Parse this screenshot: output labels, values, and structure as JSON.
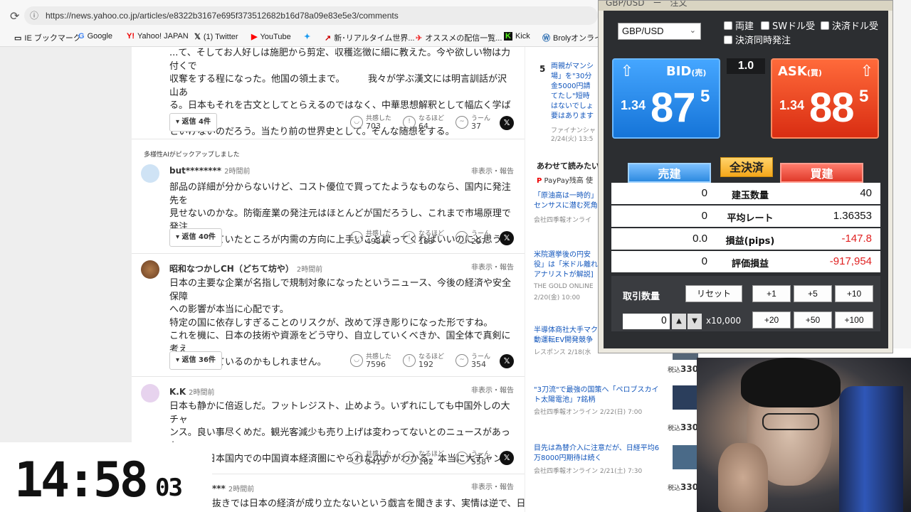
{
  "browser": {
    "url": "https://news.yahoo.co.jp/articles/e8322b3167e695f373512682b16d78a09e83e5e3/comments",
    "bookmarks": [
      "IE ブックマーク",
      "Google",
      "Yahoo! JAPAN",
      "(1) Twitter",
      "YouTube",
      "",
      "新･リアルタイム世界...",
      "オススメの配信一覧...",
      "Kick",
      "Brolyオンライン"
    ]
  },
  "comments": [
    {
      "text_lines": [
        "...て、そしてお人好しは施肥から剪定、収穫迄徴に細に教えた。今や欲しい物は力付くで",
        "収奪をする程になった。他国の領土まで。　　　我々が学ぶ漢文には明言訓話が沢山あ",
        "る。日本もそれを古文としてとらえるのではなく、中華思想解釈として幅広く学ばない",
        "といけないのだろう。当たり前の世界史として。そんな随想をする。"
      ],
      "reply": "返信 4件",
      "reactions": [
        {
          "label": "共感した",
          "count": "703"
        },
        {
          "label": "なるほど",
          "count": "64"
        },
        {
          "label": "うーん",
          "count": "37"
        }
      ]
    },
    {
      "ai_tag": "多様性AIがピックアップしました",
      "user": "but********",
      "time": "2時間前",
      "report": "非表示・報告",
      "text_lines": [
        "部品の詳細が分からないけど、コスト優位で買ってたようなものなら、国内に発注先を",
        "見せないのかな。防衛産業の発注元はほとんどが国だろうし、これまで市場原理で発注",
        "先選定されていたところが内需の方向に上手いこと戻ってくればいいのにと思う。"
      ],
      "reply": "返信 40件",
      "reactions": [
        {
          "label": "共感した",
          "count": "4984"
        },
        {
          "label": "なるほど",
          "count": "183"
        },
        {
          "label": "うーん",
          "count": "297"
        }
      ]
    },
    {
      "user": "昭和なつかしCH（どちて坊や）",
      "time": "2時間前",
      "report": "非表示・報告",
      "text_lines": [
        "日本の主要な企業が名指しで規制対象になったというニュース、今後の経済や安全保障",
        "への影響が本当に心配です。",
        "特定の国に依存しすぎることのリスクが、改めて浮き彫りになった形ですね。",
        "これを機に、日本の技術や資源をどう守り、自立していくべきか、国全体で真剣に考え",
        "る時期に来ているのかもしれません。"
      ],
      "reply": "返信 36件",
      "reactions": [
        {
          "label": "共感した",
          "count": "7596"
        },
        {
          "label": "なるほど",
          "count": "192"
        },
        {
          "label": "うーん",
          "count": "354"
        }
      ]
    },
    {
      "user": "K.K",
      "time": "2時間前",
      "report": "非表示・報告",
      "text_lines": [
        "日本も静かに倍返しだ。フットレジスト、止めよう。いずれにしても中国外しの大チャ",
        "ンス。良い事尽くめだ。観光客減少も売り上げは変わってないとのニュースがあった。",
        "どれだけ日本国内での中国資本経済圏にやられたのかがわかる。本当に大チャンスだ。"
      ],
      "reactions": [
        {
          "label": "共感した",
          "count": "8415"
        },
        {
          "label": "なるほど",
          "count": "182"
        },
        {
          "label": "うーん",
          "count": "558"
        }
      ]
    },
    {
      "user": "***",
      "time": "2時間前",
      "report": "非表示・報告",
      "text_lines": [
        "抜きでは日本の経済が成り立たないという戯言を聞きます、実情は逆で、日"
      ]
    }
  ],
  "side": {
    "item5_num": "5",
    "item5_lines": [
      "両親がマンシ",
      "場」を\"30分",
      "金5000円請",
      "てたし\"短時",
      "はないでしょ",
      "要はあります"
    ],
    "item5_meta": "ファイナンシャ",
    "item5_date": "2/24(火) 13:5",
    "related_head": "あわせて読みたい",
    "paypay": "PayPay残高 使",
    "r1": [
      "「原油高は一時的」",
      "センサスに潜む死角"
    ],
    "r1_meta": "会社四季報オンライ",
    "r2": [
      "米院選挙後の円安",
      "役」は「米ドル離れ",
      "アナリストが解説]"
    ],
    "r2_meta": "THE GOLD ONLINE",
    "r2_date": "2/20(金) 10:00",
    "r3": [
      "半導体商社大手マク",
      "動運転EV開発競争"
    ],
    "r3_meta": "レスポンス 2/18(水"
  },
  "rcol": {
    "items": [
      {
        "lines": [
          "\"3刀流\"で最強の国策へ「ペロブスカイ",
          "ト太陽電池」7銘柄"
        ],
        "meta": "会社四季報オンライン 2/22(日) 7:00",
        "price": "税込",
        "price_val": "330"
      },
      {
        "lines": [
          "目先は為替介入に注意だが、日経平均6",
          "万8000円期待は続く"
        ],
        "meta": "会社四季報オンライン 2/21(土) 7:30",
        "price": "税込",
        "price_val": "330"
      }
    ],
    "top_price": "税込",
    "top_price_val": "330"
  },
  "panel": {
    "title": "GBP/USD　ー　注文",
    "pair": "GBP/USD",
    "options": [
      "両建",
      "SWドル受",
      "決済ドル受",
      "決済同時発注"
    ],
    "bid": {
      "label": "BID",
      "sub": "(売)",
      "small": "1.34",
      "big": "87",
      "sup": "5"
    },
    "ask": {
      "label": "ASK",
      "sub": "(買)",
      "small": "1.34",
      "big": "88",
      "sup": "5"
    },
    "spread": "1.0",
    "tabs": {
      "sell": "売建",
      "close_all": "全決済",
      "buy": "買建"
    },
    "rows": [
      {
        "left": "0",
        "center": "建玉数量",
        "right": "40",
        "neg": false
      },
      {
        "left": "0",
        "center": "平均レート",
        "right": "1.36353",
        "neg": false
      },
      {
        "left": "0.0",
        "center": "損益(pips)",
        "right": "-147.8",
        "neg": true
      },
      {
        "left": "0",
        "center": "評価損益",
        "right": "-917,954",
        "neg": true
      }
    ],
    "qty_label": "取引数量",
    "reset": "リセット",
    "add_buttons": [
      "+1",
      "+5",
      "+10",
      "+20",
      "+50",
      "+100"
    ],
    "qty_value": "0",
    "multiplier": "x10,000"
  },
  "clock": {
    "hm": "14:58",
    "sec": "03"
  }
}
